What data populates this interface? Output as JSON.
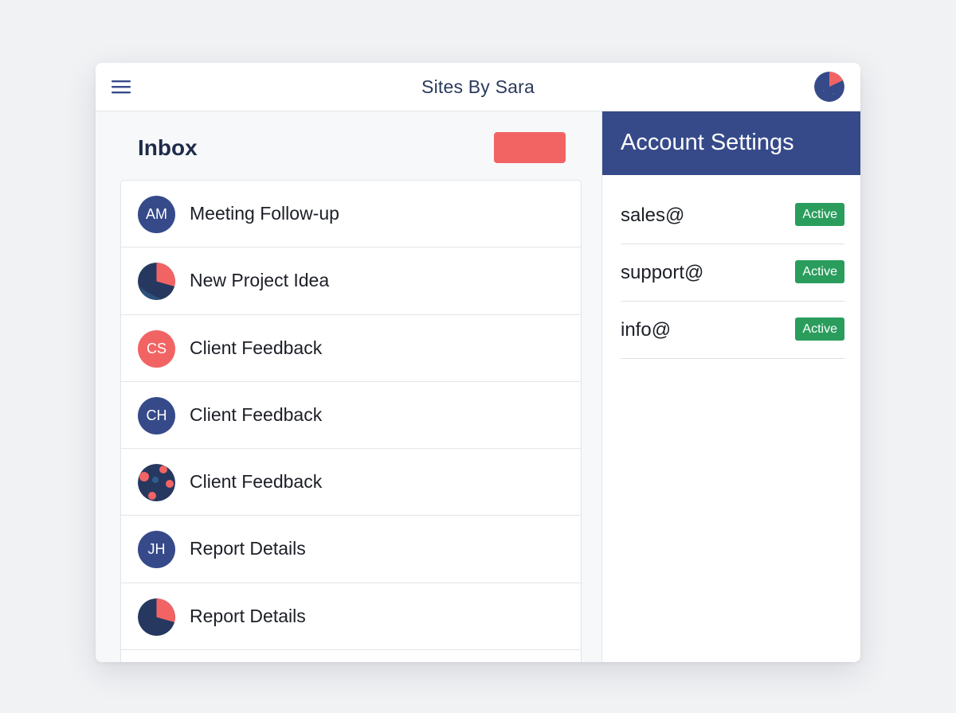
{
  "header": {
    "title": "Sites By Sara",
    "menu_icon": "hamburger-menu-icon",
    "user_avatar_icon": "user-avatar"
  },
  "inbox": {
    "title": "Inbox",
    "compose_button_color": "#f26464",
    "messages": [
      {
        "initials": "AM",
        "subject": "Meeting Follow-up",
        "avatar_color": "#364a8a"
      },
      {
        "initials": "",
        "subject": "New Project Idea",
        "avatar_color": "pattern-navy-coral"
      },
      {
        "initials": "CS",
        "subject": "Client Feedback",
        "avatar_color": "#f26464"
      },
      {
        "initials": "CH",
        "subject": "Client Feedback",
        "avatar_color": "#364a8a"
      },
      {
        "initials": "",
        "subject": "Client Feedback",
        "avatar_color": "pattern-navy-dots"
      },
      {
        "initials": "JH",
        "subject": "Report Details",
        "avatar_color": "#364a8a"
      },
      {
        "initials": "",
        "subject": "Report Details",
        "avatar_color": "pattern-navy-coral"
      }
    ]
  },
  "settings": {
    "title": "Account Settings",
    "accounts": [
      {
        "email": "sales@",
        "status": "Active"
      },
      {
        "email": "support@",
        "status": "Active"
      },
      {
        "email": "info@",
        "status": "Active"
      }
    ]
  },
  "colors": {
    "navy": "#364a8a",
    "coral": "#f26464",
    "active_green": "#2a9d5c",
    "background": "#f1f2f4"
  }
}
